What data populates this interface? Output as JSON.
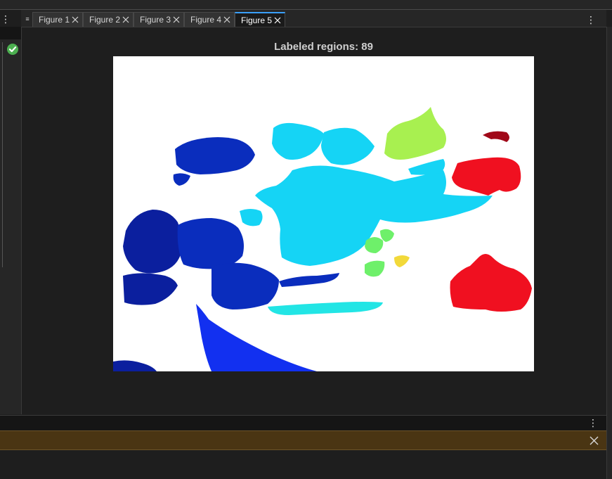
{
  "window": {
    "menu_glyph": "⋮"
  },
  "sidebar": {
    "status_icon": "check-circle-icon",
    "status_color": "#4caf50"
  },
  "tabs": {
    "menu_glyph": "≡",
    "items": [
      {
        "label": "Figure 1",
        "active": false
      },
      {
        "label": "Figure 2",
        "active": false
      },
      {
        "label": "Figure 3",
        "active": false
      },
      {
        "label": "Figure 4",
        "active": false
      },
      {
        "label": "Figure 5",
        "active": true
      }
    ],
    "more_glyph": "⋮"
  },
  "figure": {
    "title": "Labeled regions: 89",
    "colors": {
      "dark_navy": "#0b1f9e",
      "navy": "#0a2dbd",
      "blue": "#1230f0",
      "cyan": "#15d4f5",
      "light_cyan": "#22e5e5",
      "green": "#6ef06a",
      "yellow_green": "#a8f050",
      "yellow": "#f2d93a",
      "red": "#f01020",
      "dark_red": "#a00818"
    }
  },
  "bottom_panel": {
    "menu_glyph": "⋮",
    "close_icon": "close-icon"
  },
  "accent": "#3aa0ff"
}
